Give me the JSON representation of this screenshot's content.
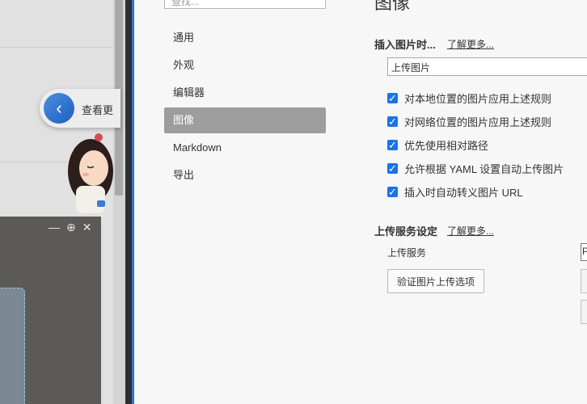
{
  "background_app": {
    "floating_button_text": "查看更",
    "window_controls": [
      "—",
      "⊕",
      "✕"
    ]
  },
  "settings": {
    "search_placeholder": "查找...",
    "nav": [
      {
        "label": "通用",
        "active": false
      },
      {
        "label": "外观",
        "active": false
      },
      {
        "label": "编辑器",
        "active": false
      },
      {
        "label": "图像",
        "active": true
      },
      {
        "label": "Markdown",
        "active": false
      },
      {
        "label": "导出",
        "active": false
      }
    ],
    "page_title": "图像",
    "insert_section": {
      "label": "插入图片时...",
      "learn_more": "了解更多...",
      "selected_option": "上传图片",
      "checkboxes": [
        {
          "label": "对本地位置的图片应用上述规则",
          "checked": true
        },
        {
          "label": "对网络位置的图片应用上述规则",
          "checked": true
        },
        {
          "label": "优先使用相对路径",
          "checked": true
        },
        {
          "label": "允许根据 YAML 设置自动上传图片",
          "checked": true
        },
        {
          "label": "插入时自动转义图片 URL",
          "checked": true
        }
      ]
    },
    "upload_section": {
      "label": "上传服务设定",
      "learn_more": "了解更多...",
      "service_label": "上传服务",
      "service_value": "P",
      "verify_button": "验证图片上传选项"
    }
  },
  "colors": {
    "accent_blue": "#1a73e8",
    "active_nav": "#9d9d9d"
  }
}
